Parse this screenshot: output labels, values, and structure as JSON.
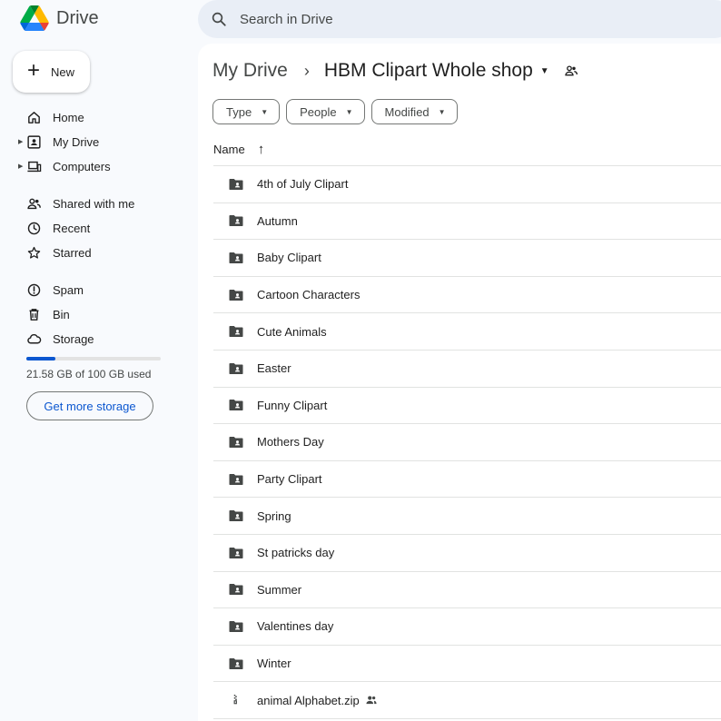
{
  "app": {
    "name": "Drive"
  },
  "search": {
    "placeholder": "Search in Drive"
  },
  "new_button": {
    "label": "New"
  },
  "sidebar": {
    "items": [
      {
        "label": "Home",
        "icon": "home-icon",
        "expandable": false
      },
      {
        "label": "My Drive",
        "icon": "my-drive-icon",
        "expandable": true
      },
      {
        "label": "Computers",
        "icon": "computers-icon",
        "expandable": true
      },
      {
        "label": "Shared with me",
        "icon": "people-icon",
        "expandable": false
      },
      {
        "label": "Recent",
        "icon": "clock-icon",
        "expandable": false
      },
      {
        "label": "Starred",
        "icon": "star-icon",
        "expandable": false
      },
      {
        "label": "Spam",
        "icon": "spam-icon",
        "expandable": false
      },
      {
        "label": "Bin",
        "icon": "bin-icon",
        "expandable": false
      },
      {
        "label": "Storage",
        "icon": "cloud-icon",
        "expandable": false
      }
    ]
  },
  "storage": {
    "used_text": "21.58 GB of 100 GB used",
    "used_fraction": 0.2158,
    "button_label": "Get more storage"
  },
  "breadcrumb": {
    "root": "My Drive",
    "separator": "›",
    "current": "HBM Clipart Whole shop"
  },
  "filters": [
    {
      "label": "Type"
    },
    {
      "label": "People"
    },
    {
      "label": "Modified"
    }
  ],
  "columns": {
    "name": "Name",
    "sort_arrow": "↑"
  },
  "files": [
    {
      "name": "4th of July Clipart",
      "kind": "shared-folder"
    },
    {
      "name": "Autumn",
      "kind": "shared-folder"
    },
    {
      "name": "Baby Clipart",
      "kind": "shared-folder"
    },
    {
      "name": "Cartoon Characters",
      "kind": "shared-folder"
    },
    {
      "name": "Cute Animals",
      "kind": "shared-folder"
    },
    {
      "name": "Easter",
      "kind": "shared-folder"
    },
    {
      "name": "Funny Clipart",
      "kind": "shared-folder"
    },
    {
      "name": "Mothers Day",
      "kind": "shared-folder"
    },
    {
      "name": "Party Clipart",
      "kind": "shared-folder"
    },
    {
      "name": "Spring",
      "kind": "shared-folder"
    },
    {
      "name": "St patricks day",
      "kind": "shared-folder"
    },
    {
      "name": "Summer",
      "kind": "shared-folder"
    },
    {
      "name": "Valentines day",
      "kind": "shared-folder"
    },
    {
      "name": "Winter",
      "kind": "shared-folder"
    },
    {
      "name": "animal Alphabet.zip",
      "kind": "zip",
      "shared": true
    }
  ],
  "colors": {
    "accent": "#0b57d0",
    "background": "#f8fafd",
    "search_bg": "#e9eef6"
  }
}
